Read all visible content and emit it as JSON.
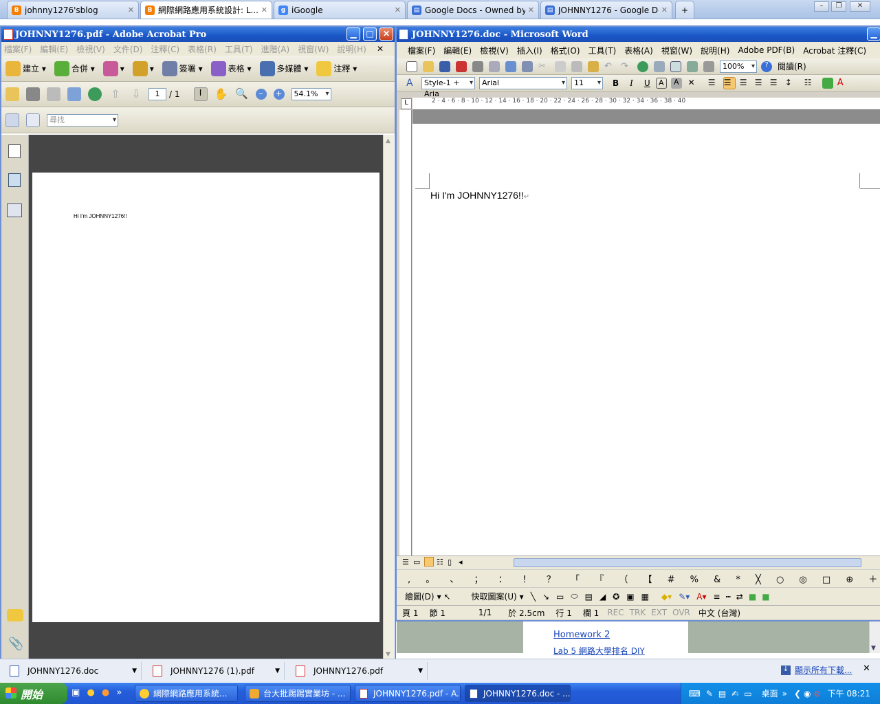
{
  "browser": {
    "tabs": [
      {
        "label": "johnny1276'sblog",
        "color": "#f57d00"
      },
      {
        "label": "網際網路應用系統設計: L...",
        "color": "#f57d00"
      },
      {
        "label": "iGoogle",
        "color": "#4285f4"
      },
      {
        "label": "Google Docs - Owned by me",
        "color": "#3a6fd8"
      },
      {
        "label": "JOHNNY1276 - Google Docs",
        "color": "#3a6fd8"
      }
    ],
    "new_tab": "+"
  },
  "acrobat": {
    "title": "JOHNNY1276.pdf - Adobe Acrobat Pro",
    "menu": [
      "檔案(F)",
      "編輯(E)",
      "檢視(V)",
      "文件(D)",
      "注釋(C)",
      "表格(R)",
      "工具(T)",
      "進階(A)",
      "視窗(W)",
      "說明(H)"
    ],
    "toolbar1": [
      "建立",
      "合併",
      "簽署",
      "表格",
      "多媒體",
      "注釋"
    ],
    "page_current": "1",
    "page_total": "/ 1",
    "zoom": "54.1%",
    "find_placeholder": "尋找",
    "page_text": "Hi I'm JOHNNY1276!!"
  },
  "word": {
    "title": "JOHNNY1276.doc - Microsoft Word",
    "menu": [
      "檔案(F)",
      "編輯(E)",
      "檢視(V)",
      "插入(I)",
      "格式(O)",
      "工具(T)",
      "表格(A)",
      "視窗(W)",
      "說明(H)",
      "Adobe PDF(B)",
      "Acrobat 注釋(C)"
    ],
    "zoom": "100%",
    "read_label": "閱讀(R)",
    "style": "Style-1 + Aria",
    "font": "Arial",
    "size": "11",
    "ruler_h": "2 · 4 · 6 · 8 · 10 · 12 · 14 · 16 · 18 · 20 · 22 · 24 · 26 · 28 · 30 · 32 · 34 · 36 · 38 · 40",
    "doc_text": "Hi I'm JOHNNY1276!!",
    "para_mark": "↵",
    "symbols": ", 。 、 ； ： ！ ？ 「 『 （ 【 # % & * ╳ ○ ◎ □ ⊕ ＋ － × ÷ ＜ ＞ ＝ $ ￥ €",
    "draw_label": "繪圖(D)",
    "autoshape_label": "快取圖案(U)",
    "status": {
      "page": "頁 1",
      "section": "節 1",
      "pages": "1/1",
      "at": "於 2.5cm",
      "line": "行 1",
      "col": "欄 1",
      "rec": "REC",
      "trk": "TRK",
      "ext": "EXT",
      "ovr": "OVR",
      "lang": "中文 (台灣)"
    }
  },
  "webpage": {
    "link1": "Homework 2",
    "link2": "Lab 5 網路大學排名 DIY"
  },
  "downloads": {
    "items": [
      "JOHNNY1276.doc",
      "JOHNNY1276 (1).pdf",
      "JOHNNY1276.pdf"
    ],
    "show_all": "顯示所有下載...",
    "close": "✕"
  },
  "taskbar": {
    "start": "開始",
    "tasks": [
      "網際網路應用系統...",
      "台大批踢踢實業坊 - ...",
      "JOHNNY1276.pdf - A...",
      "JOHNNY1276.doc - ..."
    ],
    "desktop": "桌面",
    "clock": "下午 08:21"
  }
}
